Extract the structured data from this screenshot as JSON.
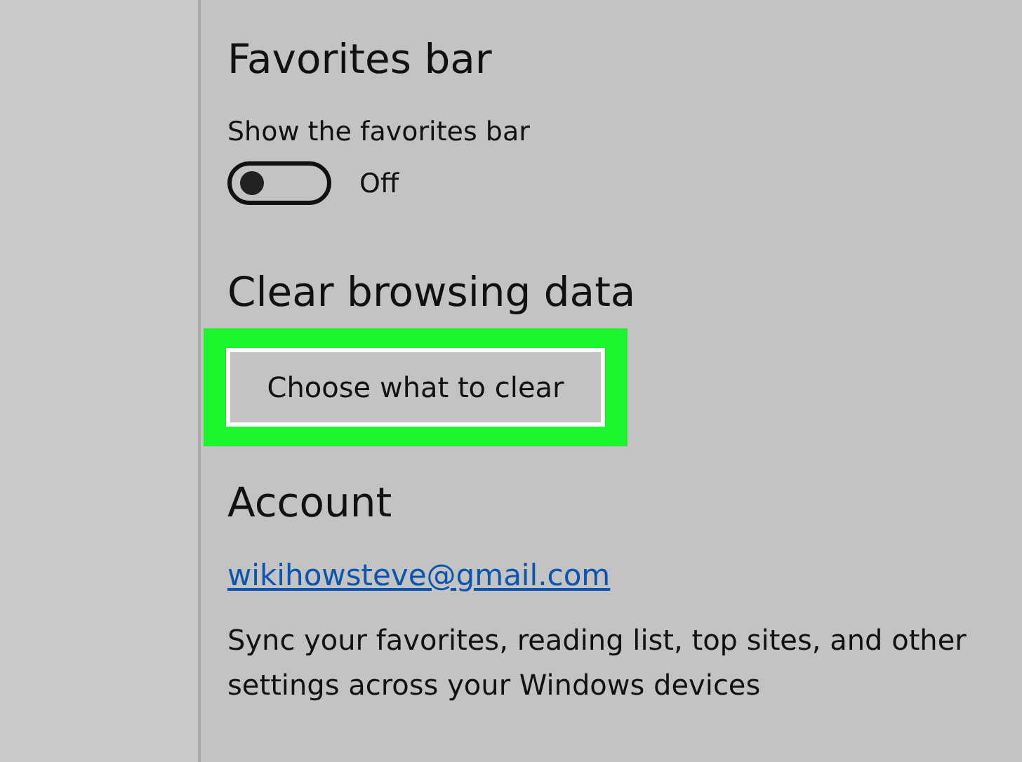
{
  "favorites_bar": {
    "heading": "Favorites bar",
    "setting_label": "Show the favorites bar",
    "toggle": {
      "on": false,
      "state_text": "Off"
    }
  },
  "clear_browsing_data": {
    "heading": "Clear browsing data",
    "button": {
      "label": "Choose what to clear",
      "highlighted": true
    }
  },
  "account": {
    "heading": "Account",
    "email_link": "wikihowsteve@gmail.com",
    "sync_text": "Sync your favorites, reading list, top sites, and other settings across your Windows devices"
  }
}
